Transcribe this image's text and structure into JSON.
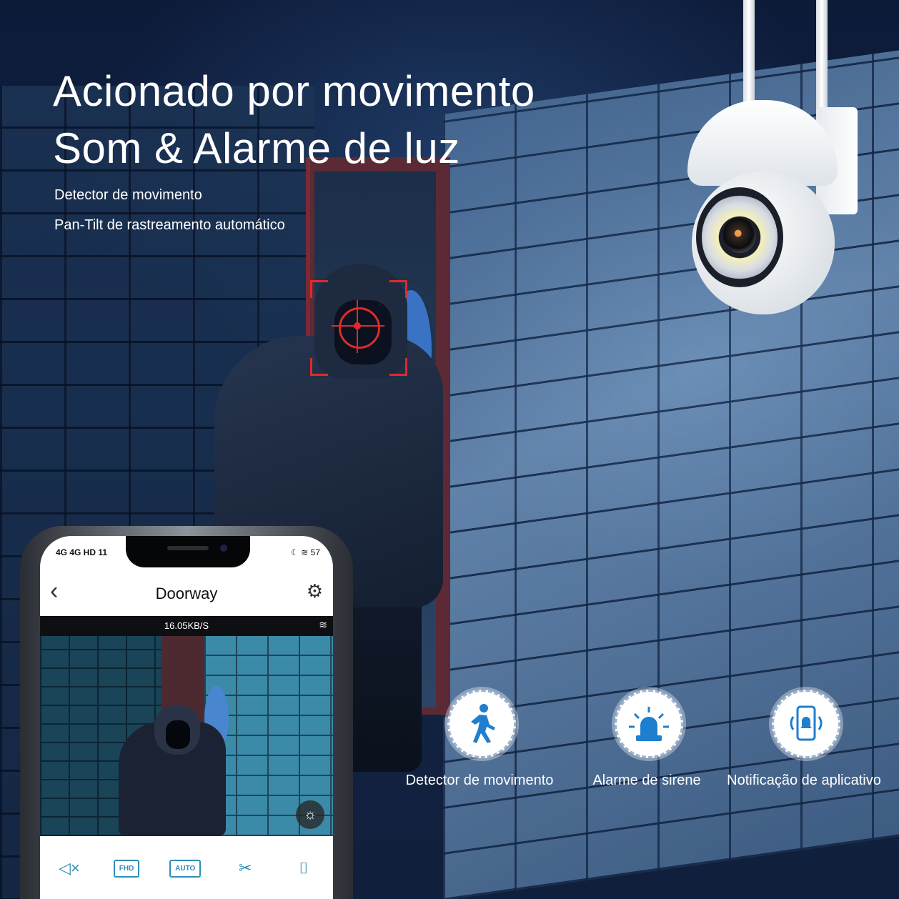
{
  "headline": {
    "line1": "Acionado por movimento",
    "line2": "Som & Alarme de luz"
  },
  "sub_features": [
    "Detector de movimento",
    "Pan-Tilt de rastreamento automático"
  ],
  "features": [
    {
      "icon": "walking-person-icon",
      "label": "Detector de movimento"
    },
    {
      "icon": "siren-icon",
      "label": "Alarme de sirene"
    },
    {
      "icon": "phone-notification-icon",
      "label": "Notificação de aplicativo"
    }
  ],
  "phone": {
    "status_left": "4G 4G HD 11",
    "status_right": "☾ ≋ 57",
    "app_title": "Doorway",
    "rate": "16.05KB/S",
    "toolbar": {
      "mute": "◁×",
      "fhd": "FHD",
      "auto": "AUTO",
      "scissors": "✂",
      "portrait": "⌷"
    }
  },
  "colors": {
    "accent": "#2f8fb8",
    "target": "#e02a2a",
    "headline": "#ffffff"
  }
}
